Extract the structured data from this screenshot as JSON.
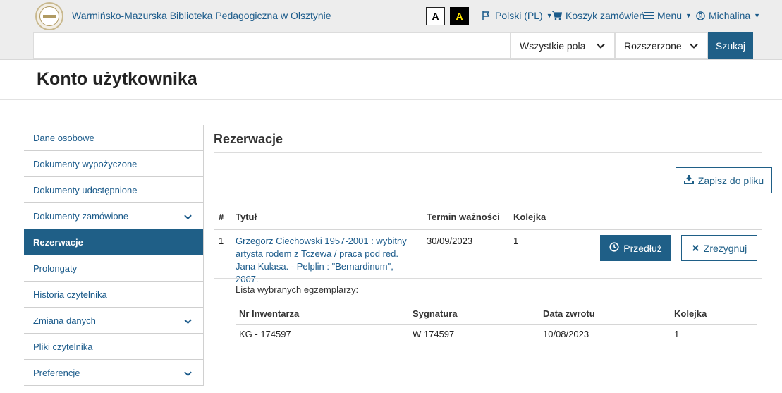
{
  "header": {
    "site_title": "Warmińsko-Mazurska Biblioteka Pedagogiczna w Olsztynie",
    "contrast_normal": "A",
    "contrast_high": "A",
    "language_label": "Polski (PL)",
    "cart_label": "Koszyk zamówień",
    "menu_label": "Menu",
    "user_label": "Michalina"
  },
  "search": {
    "query": "",
    "field_select": "Wszystkie pola",
    "mode_select": "Rozszerzone",
    "button_label": "Szukaj"
  },
  "page_title": "Konto użytkownika",
  "sidebar": {
    "items": [
      {
        "label": "Dane osobowe"
      },
      {
        "label": "Dokumenty wypożyczone"
      },
      {
        "label": "Dokumenty udostępnione"
      },
      {
        "label": "Dokumenty zamówione"
      },
      {
        "label": "Rezerwacje"
      },
      {
        "label": "Prolongaty"
      },
      {
        "label": "Historia czytelnika"
      },
      {
        "label": "Zmiana danych"
      },
      {
        "label": "Pliki czytelnika"
      },
      {
        "label": "Preferencje"
      }
    ]
  },
  "main": {
    "section_title": "Rezerwacje",
    "save_button": "Zapisz do pliku",
    "table": {
      "columns": [
        "#",
        "Tytuł",
        "Termin ważności",
        "Kolejka"
      ],
      "row": {
        "index": "1",
        "title": "Grzegorz Ciechowski 1957-2001 : wybitny artysta rodem z Tczewa / praca pod red. Jana Kulasa. - Pelplin : \"Bernardinum\", 2007.",
        "expiry": "30/09/2023",
        "queue": "1",
        "extend_button": "Przedłuż",
        "cancel_button": "Zrezygnuj"
      }
    },
    "copies": {
      "label": "Lista wybranych egzemplarzy:",
      "columns": [
        "Nr Inwentarza",
        "Sygnatura",
        "Data zwrotu",
        "Kolejka"
      ],
      "row": [
        "KG - 174597",
        "W 174597",
        "10/08/2023",
        "1"
      ]
    }
  }
}
